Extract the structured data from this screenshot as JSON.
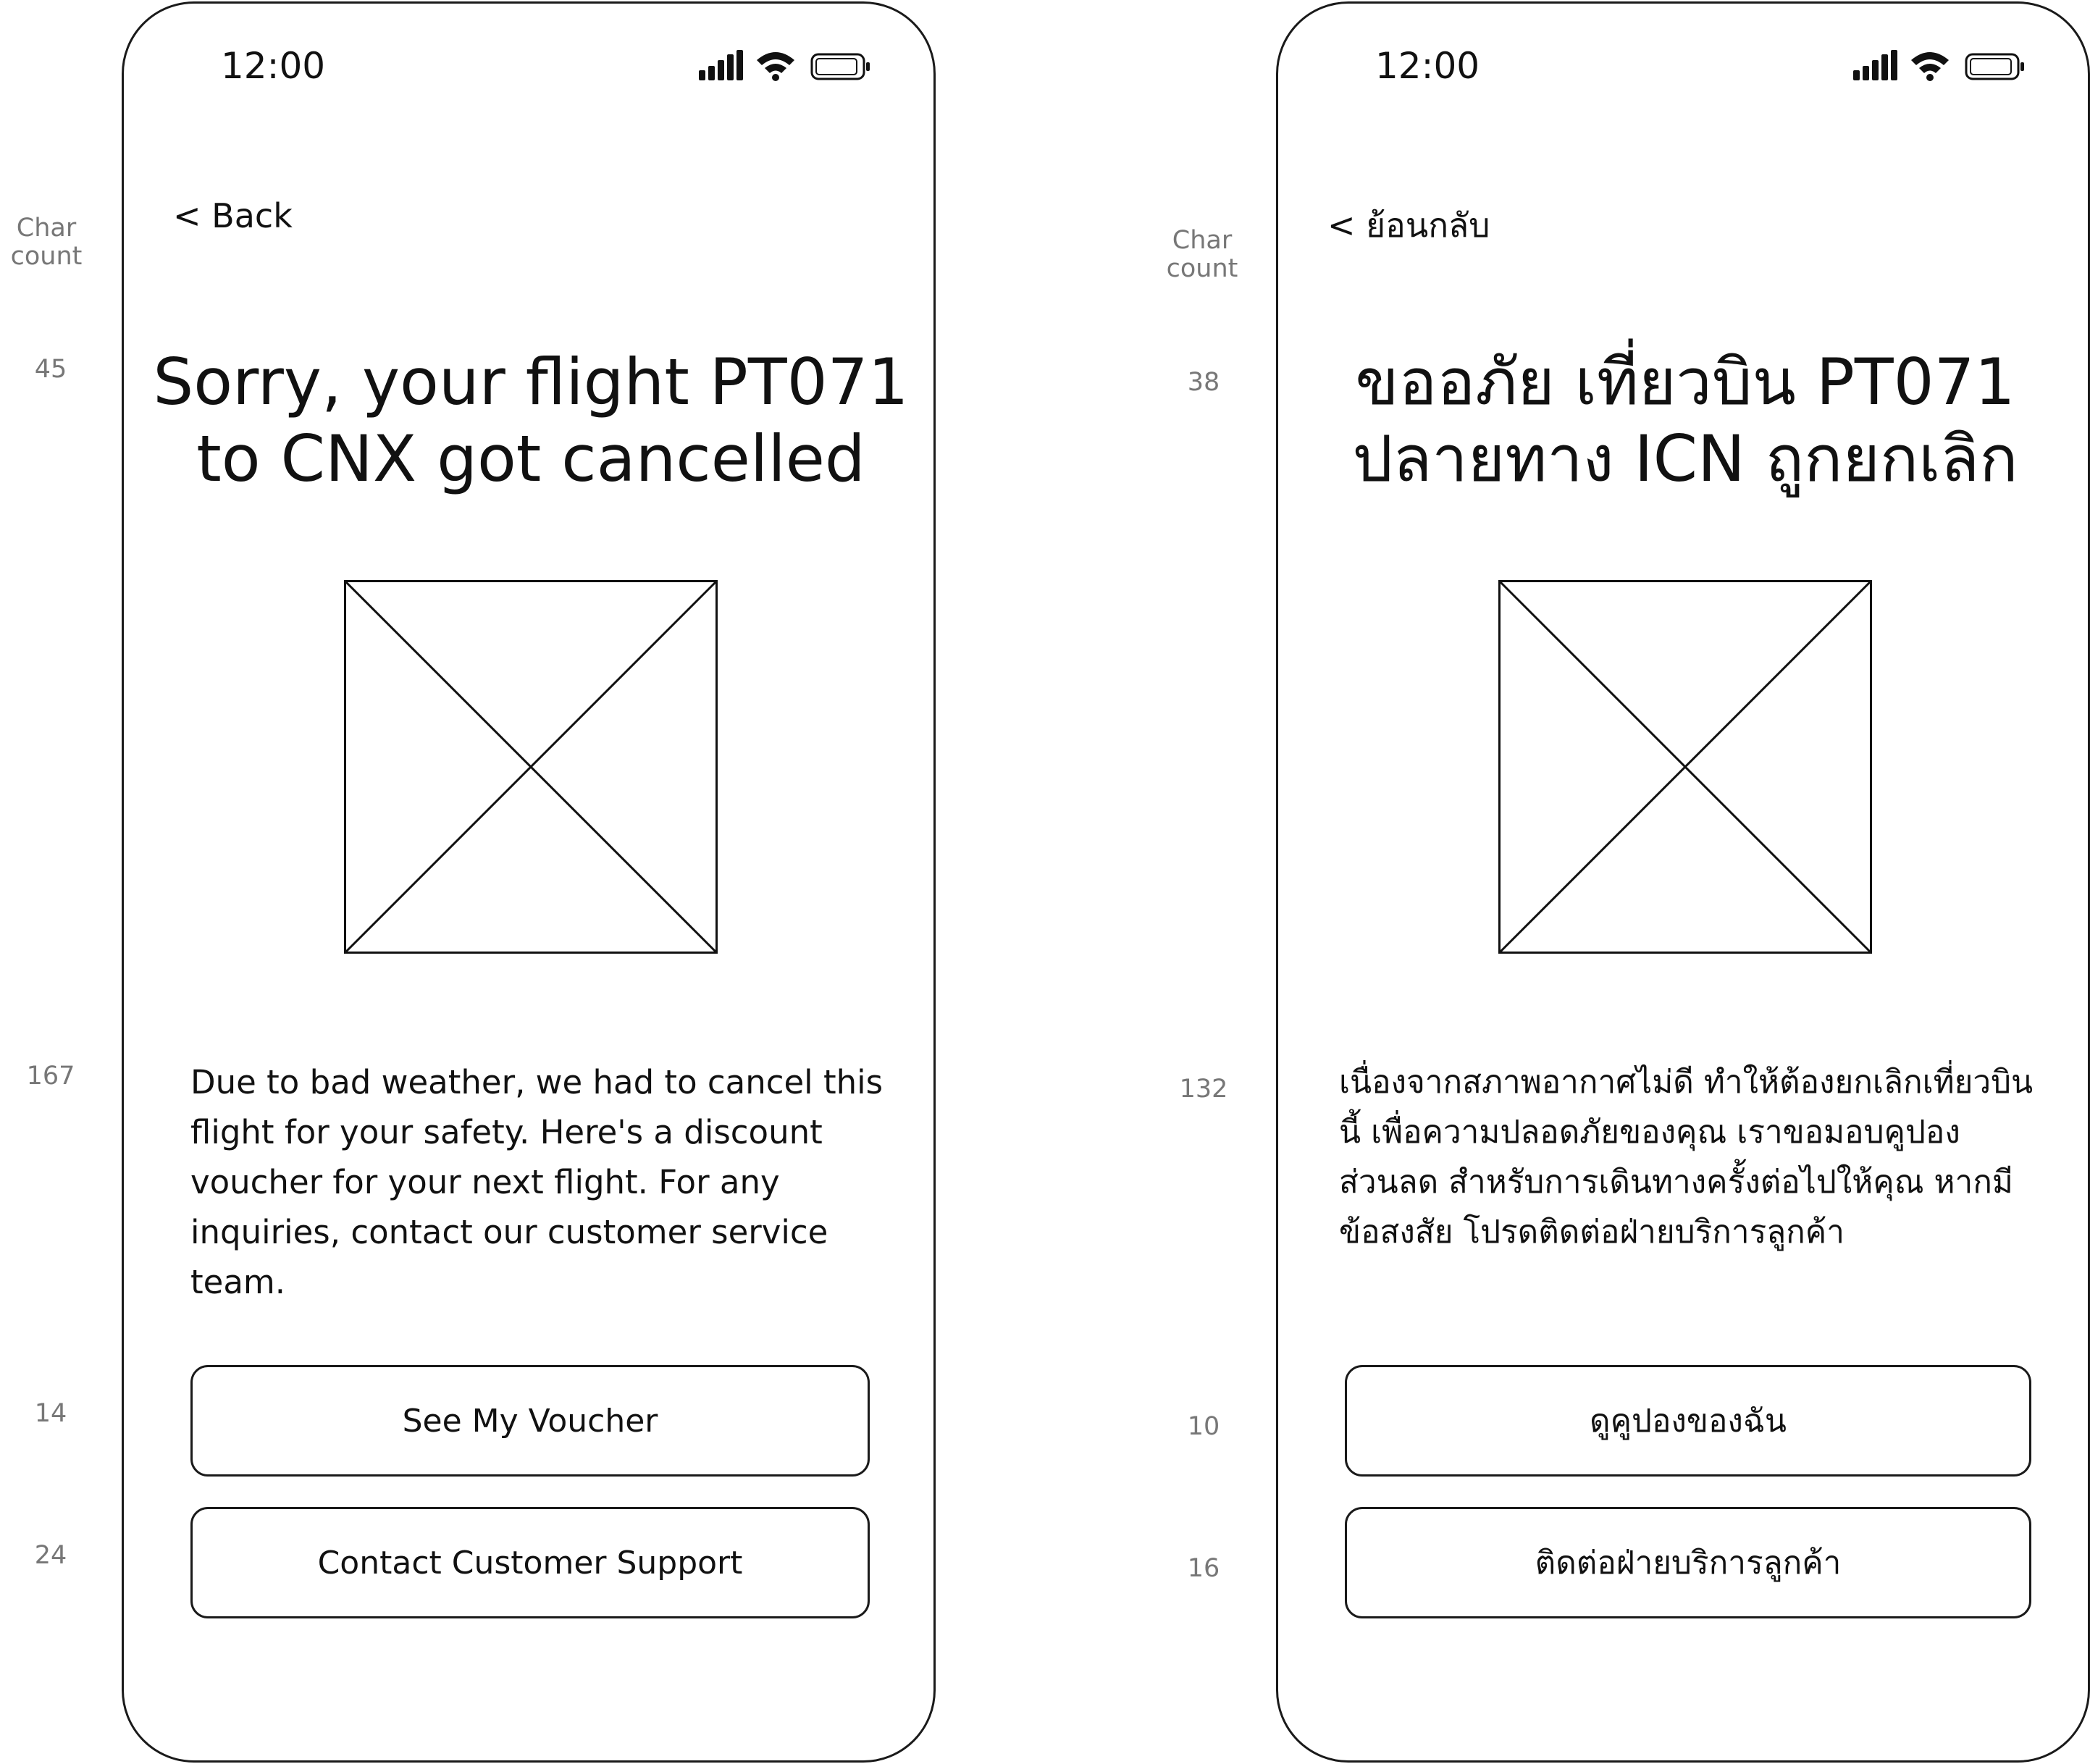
{
  "char_count_label": [
    "Char",
    "count"
  ],
  "screens": [
    {
      "status_time": "12:00",
      "back_label": "< Back",
      "headline": [
        "Sorry, your flight PT071",
        "to CNX got cancelled"
      ],
      "image_placeholder_icon": "image-placeholder-icon",
      "body": "Due to bad weather, we had to cancel this flight for your safety. Here's a discount voucher for your next flight. For any inquiries, contact our customer service team.",
      "primary_button": "See My Voucher",
      "secondary_button": "Contact Customer Support",
      "char_counts": {
        "headline": "45",
        "body": "167",
        "primary_button": "14",
        "secondary_button": "24"
      }
    },
    {
      "status_time": "12:00",
      "back_label": "< ย้อนกลับ",
      "headline": [
        "ขออภัย เที่ยวบิน PT071",
        "ปลายทาง ICN ถูกยกเลิก"
      ],
      "image_placeholder_icon": "image-placeholder-icon",
      "body": "เนื่องจากสภาพอากาศไม่ดี ทำให้ต้องยกเลิกเที่ยวบินนี้ เพื่อความปลอดภัยของคุณ เราขอมอบคูปองส่วนลด สำหรับการเดินทางครั้งต่อไปให้คุณ หากมีข้อสงสัย โปรดติดต่อฝ่ายบริการลูกค้า",
      "primary_button": "ดูคูปองของฉัน",
      "secondary_button": "ติดต่อฝ่ายบริการลูกค้า",
      "char_counts": {
        "headline": "38",
        "body": "132",
        "primary_button": "10",
        "secondary_button": "16"
      }
    }
  ],
  "status_icons": [
    "signal-icon",
    "wifi-icon",
    "battery-icon"
  ]
}
